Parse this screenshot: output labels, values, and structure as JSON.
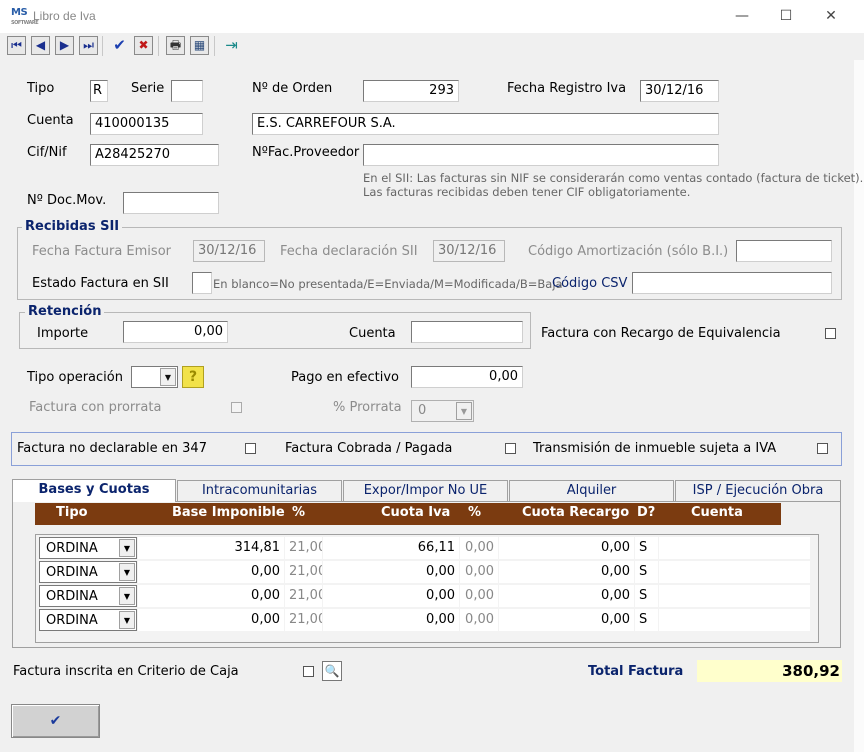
{
  "window": {
    "logo_text": "MS",
    "logo_sub": "SOFTWARE",
    "title": "Libro de Iva",
    "minimize_glyph": "—",
    "maximize_glyph": "☐",
    "close_glyph": "✕"
  },
  "toolbar": [
    {
      "name": "first-record-button",
      "icon": "first-icon",
      "glyph": "⏮",
      "color": "#1a2f8f"
    },
    {
      "name": "prev-record-button",
      "icon": "arrow-left-icon",
      "glyph": "◀",
      "color": "#1a2f8f"
    },
    {
      "name": "next-record-button",
      "icon": "arrow-right-icon",
      "glyph": "▶",
      "color": "#1a2f8f"
    },
    {
      "name": "last-record-button",
      "icon": "last-icon",
      "glyph": "⏭",
      "color": "#1a2f8f"
    },
    {
      "name": "accept-button",
      "icon": "check-icon",
      "glyph": "✔",
      "color": "#1c3fb0"
    },
    {
      "name": "cancel-button",
      "icon": "cross-icon",
      "glyph": "✖",
      "color": "#c01818"
    },
    {
      "name": "print-button",
      "icon": "printer-icon",
      "glyph": "🖶",
      "color": "#333333"
    },
    {
      "name": "calculator-button",
      "icon": "calculator-icon",
      "glyph": "▦",
      "color": "#2a4a7a"
    },
    {
      "name": "exit-button",
      "icon": "exit-door-icon",
      "glyph": "⇥",
      "color": "#1a8a8a"
    }
  ],
  "header": {
    "tipo_label": "Tipo",
    "tipo_value": "R",
    "serie_label": "Serie",
    "serie_value": "",
    "orden_label": "Nº de Orden",
    "orden_value": "293",
    "fecha_registro_label": "Fecha Registro Iva",
    "fecha_registro_value": "30/12/16",
    "cuenta_label": "Cuenta",
    "cuenta_value": "410000135",
    "cuenta_nombre": "E.S. CARREFOUR S.A.",
    "cif_label": "Cif/Nif",
    "cif_value": "A28425270",
    "nfac_label": "NºFac.Proveedor",
    "nfac_value": "",
    "note_line1": "En el SII: Las facturas sin NIF se considerarán como ventas contado (factura de ticket).",
    "note_line2": "Las facturas recibidas deben tener CIF obligatoriamente.",
    "doc_mov_label": "Nº Doc.Mov.",
    "doc_mov_value": ""
  },
  "sii": {
    "title": "Recibidas SII",
    "fecha_emisor_label": "Fecha Factura Emisor",
    "fecha_emisor_value": "30/12/16",
    "fecha_decl_label": "Fecha declaración SII",
    "fecha_decl_value": "30/12/16",
    "amort_label": "Código Amortización (sólo B.I.)",
    "amort_value": "",
    "estado_label": "Estado Factura en SII",
    "estado_hint": "En blanco=No presentada/E=Enviada/M=Modificada/B=Baja",
    "csv_label": "Código CSV",
    "csv_value": ""
  },
  "retencion": {
    "title": "Retención",
    "importe_label": "Importe",
    "importe_value": "0,00",
    "cuenta_label": "Cuenta",
    "cuenta_value": ""
  },
  "recargo_label": "Factura con Recargo de Equivalencia",
  "operacion": {
    "tipo_label": "Tipo operación",
    "tipo_value": "",
    "help_glyph": "?",
    "pago_label": "Pago en efectivo",
    "pago_value": "0,00",
    "prorrata_label": "Factura con prorrata",
    "pct_prorrata_label": "% Prorrata",
    "pct_prorrata_value": "0"
  },
  "flags": {
    "no_347_label": "Factura no declarable en 347",
    "cobrada_label": "Factura Cobrada / Pagada",
    "inmueble_label": "Transmisión de inmueble sujeta a IVA"
  },
  "tabs": [
    {
      "name": "tab-bases-cuotas",
      "label": "Bases y Cuotas"
    },
    {
      "name": "tab-intracomunitarias",
      "label": "Intracomunitarias"
    },
    {
      "name": "tab-export-import",
      "label": "Expor/Impor No UE"
    },
    {
      "name": "tab-alquiler",
      "label": "Alquiler"
    },
    {
      "name": "tab-isp",
      "label": "ISP / Ejecución Obra"
    }
  ],
  "grid": {
    "columns": [
      "Tipo",
      "Base Imponible",
      "%",
      "Cuota Iva",
      "%",
      "Cuota Recargo",
      "D?",
      "Cuenta"
    ],
    "rows": [
      {
        "tipo": "ORDINA",
        "base": "314,81",
        "pct_iva": "21,00",
        "cuota": "66,11",
        "pct_rec": "0,00",
        "recargo": "0,00",
        "d": "S",
        "cuenta": ""
      },
      {
        "tipo": "ORDINA",
        "base": "0,00",
        "pct_iva": "21,00",
        "cuota": "0,00",
        "pct_rec": "0,00",
        "recargo": "0,00",
        "d": "S",
        "cuenta": ""
      },
      {
        "tipo": "ORDINA",
        "base": "0,00",
        "pct_iva": "21,00",
        "cuota": "0,00",
        "pct_rec": "0,00",
        "recargo": "0,00",
        "d": "S",
        "cuenta": ""
      },
      {
        "tipo": "ORDINA",
        "base": "0,00",
        "pct_iva": "21,00",
        "cuota": "0,00",
        "pct_rec": "0,00",
        "recargo": "0,00",
        "d": "S",
        "cuenta": ""
      }
    ]
  },
  "footer": {
    "criterio_caja_label": "Factura inscrita en Criterio de Caja",
    "zoom_glyph": "🔍",
    "total_label": "Total Factura",
    "total_value": "380,92",
    "ok_glyph": "✔"
  },
  "colors": {
    "accent": "#0b246d",
    "grid_header": "#7b3b10",
    "total_bg": "#ffffcc"
  }
}
